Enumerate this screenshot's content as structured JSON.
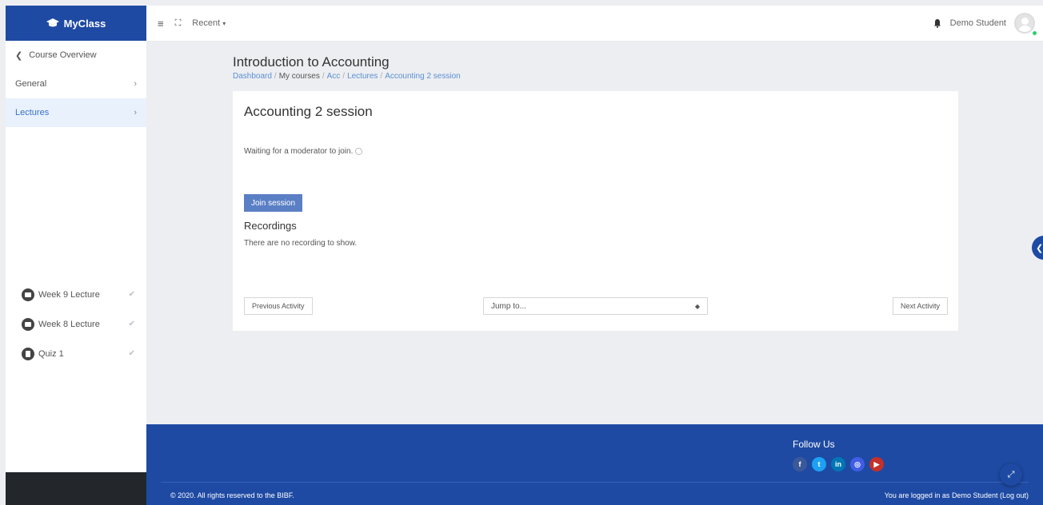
{
  "brand": {
    "name": "MyClass",
    "icon": "graduation-cap-icon"
  },
  "sidebar": {
    "back_label": "Course Overview",
    "sections": [
      {
        "label": "General",
        "active": false
      },
      {
        "label": "Lectures",
        "active": true
      }
    ],
    "activities": [
      {
        "label": "Week 9 Lecture",
        "icon": "video-icon"
      },
      {
        "label": "Week 8 Lecture",
        "icon": "video-icon"
      },
      {
        "label": "Quiz 1",
        "icon": "quiz-icon"
      }
    ]
  },
  "topbar": {
    "recent_label": "Recent",
    "user_name": "Demo Student"
  },
  "header": {
    "course_title": "Introduction to Accounting",
    "breadcrumb": [
      "Dashboard",
      "My courses",
      "Acc",
      "Lectures",
      "Accounting 2 session"
    ]
  },
  "activity": {
    "title": "Accounting 2 session",
    "waiting_text": "Waiting for a moderator to join.",
    "join_label": "Join session",
    "recordings_title": "Recordings",
    "recordings_empty": "There are no recording to show.",
    "prev_label": "Previous Activity",
    "jump_placeholder": "Jump to...",
    "next_label": "Next Activity"
  },
  "footer": {
    "follow_label": "Follow Us",
    "socials": [
      {
        "name": "facebook-icon",
        "glyph": "f",
        "color": "#3b5998"
      },
      {
        "name": "twitter-icon",
        "glyph": "t",
        "color": "#1da1f2"
      },
      {
        "name": "linkedin-icon",
        "glyph": "in",
        "color": "#0077b5"
      },
      {
        "name": "instagram-icon",
        "glyph": "◎",
        "color": "#405de6"
      },
      {
        "name": "youtube-icon",
        "glyph": "▶",
        "color": "#c4302b"
      }
    ],
    "copyright": "© 2020. All rights reserved to the BIBF.",
    "logged_in_text": "You are logged in as Demo Student (Log out)"
  },
  "colors": {
    "primary": "#1e4aa3",
    "link": "#5b8fd6",
    "button": "#5b7fc5"
  }
}
